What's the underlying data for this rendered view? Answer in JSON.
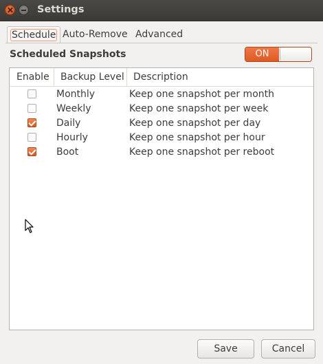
{
  "window": {
    "title": "Settings"
  },
  "tabs": [
    {
      "label": "Schedule",
      "active": true
    },
    {
      "label": "Auto-Remove",
      "active": false
    },
    {
      "label": "Advanced",
      "active": false
    }
  ],
  "schedule": {
    "section_title": "Scheduled Snapshots",
    "toggle_label": "ON",
    "toggle_state": true,
    "columns": [
      "Enable",
      "Backup Level",
      "Description"
    ],
    "rows": [
      {
        "enabled": false,
        "level": "Monthly",
        "description": "Keep one snapshot per month"
      },
      {
        "enabled": false,
        "level": "Weekly",
        "description": "Keep one snapshot per week"
      },
      {
        "enabled": true,
        "level": "Daily",
        "description": "Keep one snapshot per day"
      },
      {
        "enabled": false,
        "level": "Hourly",
        "description": "Keep one snapshot per hour"
      },
      {
        "enabled": true,
        "level": "Boot",
        "description": "Keep one snapshot per reboot"
      }
    ]
  },
  "buttons": {
    "save": "Save",
    "cancel": "Cancel"
  },
  "colors": {
    "accent": "#df5a22",
    "titlebar": "#3b3a37",
    "window_bg": "#f2f1f0"
  }
}
